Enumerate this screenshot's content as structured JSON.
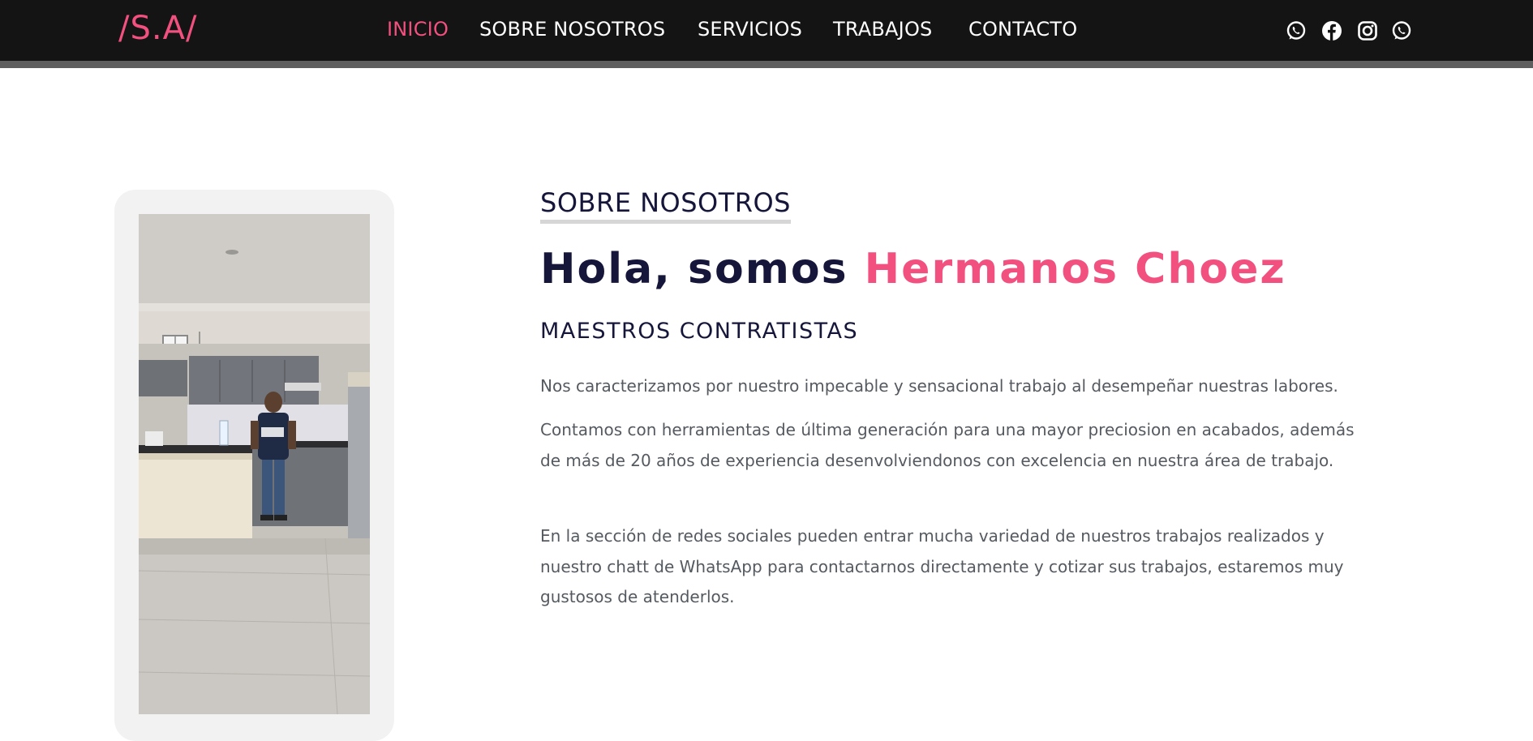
{
  "nav": {
    "brand": "/S.A/",
    "links": [
      {
        "label": "INICIO",
        "active": true
      },
      {
        "label": "SOBRE NOSOTROS",
        "active": false
      },
      {
        "label": "SERVICIOS",
        "active": false
      },
      {
        "label": "TRABAJOS",
        "active": false
      },
      {
        "label": "CONTACTO",
        "active": false
      }
    ],
    "social_icons": [
      "whatsapp-icon",
      "facebook-icon",
      "instagram-icon",
      "whatsapp-icon"
    ]
  },
  "about": {
    "section_label": "SOBRE NOSOTROS",
    "headline_prefix": "Hola, somos ",
    "headline_accent": "Hermanos Choez",
    "subheadline": "MAESTROS CONTRATISTAS",
    "paragraphs": [
      "Nos caracterizamos por nuestro impecable y sensacional trabajo al desempeñar nuestras labores.",
      "Contamos con herramientas de última generación para una mayor preciosion en acabados, además de más de 20 años de experiencia desenvolviendonos con excelencia en nuestra área de trabajo.",
      "En la sección de redes sociales pueden entrar mucha variedad de nuestros trabajos realizados y nuestro chatt de WhatsApp para contactarnos directamente y cotizar sus trabajos, estaremos muy gustosos de atenderlos."
    ]
  },
  "colors": {
    "nav_background": "#141414",
    "accent": "#f2507f",
    "heading": "#15163a",
    "body_text": "#555a60",
    "frame": "#f2f2f2"
  }
}
